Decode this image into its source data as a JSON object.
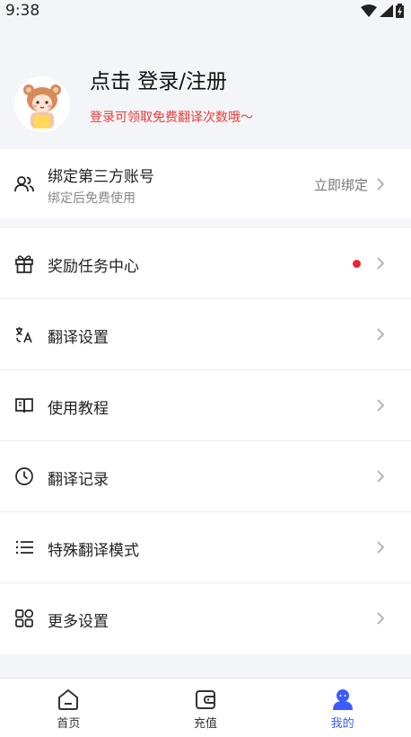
{
  "status_bar": {
    "time": "9:38"
  },
  "profile": {
    "title": "点击 登录/注册",
    "subtitle": "登录可领取免费翻译次数哦～"
  },
  "bind_account": {
    "icon": "users-icon",
    "title": "绑定第三方账号",
    "subtitle": "绑定后免费使用",
    "action": "立即绑定"
  },
  "menu": {
    "items": [
      {
        "label": "奖励任务中心",
        "icon": "gift-icon",
        "badge": "red-dot"
      },
      {
        "label": "翻译设置",
        "icon": "translate-icon"
      },
      {
        "label": "使用教程",
        "icon": "book-icon"
      },
      {
        "label": "翻译记录",
        "icon": "clock-icon"
      },
      {
        "label": "特殊翻译模式",
        "icon": "list-icon"
      },
      {
        "label": "更多设置",
        "icon": "grid-icon"
      }
    ]
  },
  "tabbar": {
    "tabs": [
      {
        "label": "首页",
        "icon": "home-icon"
      },
      {
        "label": "充值",
        "icon": "wallet-icon"
      },
      {
        "label": "我的",
        "icon": "user-icon",
        "active": true
      }
    ],
    "active_color": "#3b5bff"
  }
}
